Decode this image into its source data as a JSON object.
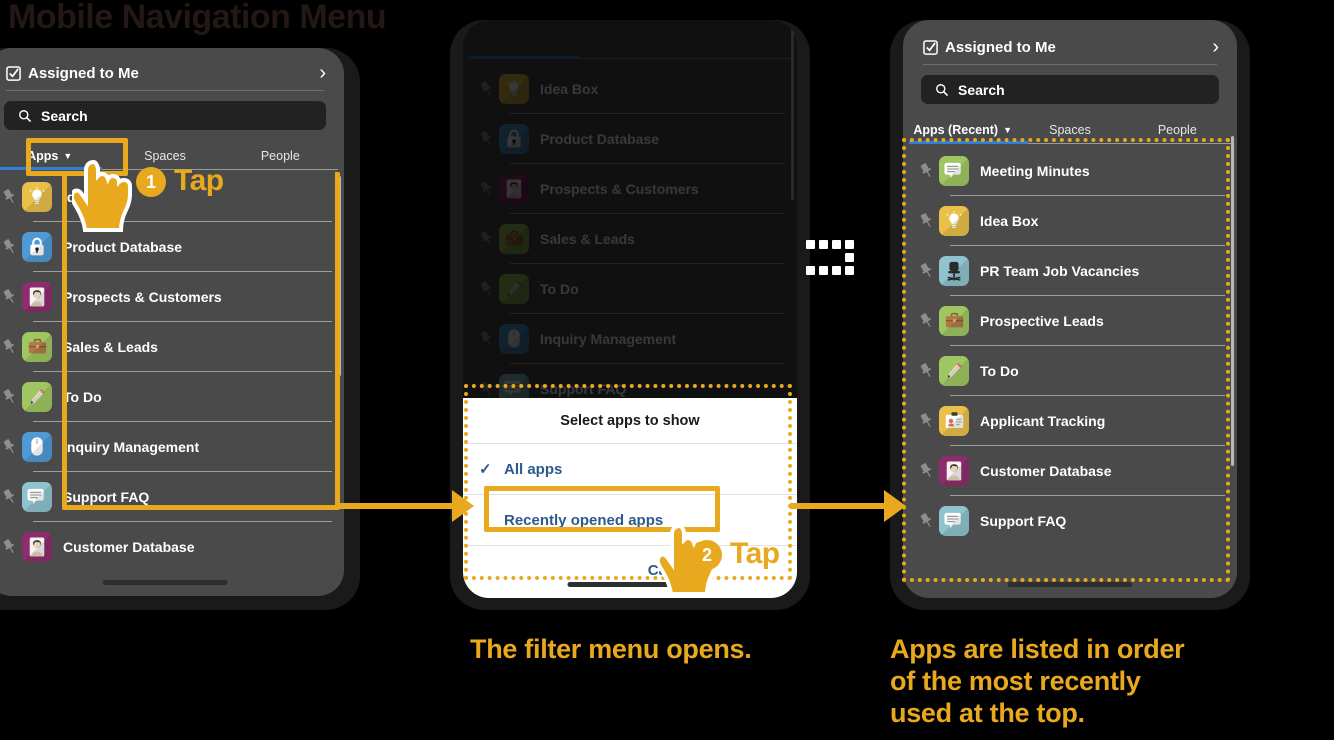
{
  "page": {
    "title": "Mobile Navigation Menu"
  },
  "colors": {
    "accent": "#e8a91e",
    "title": "#231815",
    "tab_active": "#2f80d8",
    "dialog_text": "#2b5a8c"
  },
  "common": {
    "assigned_label": "Assigned to Me",
    "assigned_icon": "checkbox-icon",
    "chevron": "›",
    "search_placeholder": "Search",
    "search_icon": "search-icon",
    "pin_icon": "pin-icon",
    "caret": "▼"
  },
  "phone1": {
    "tabs": [
      {
        "label": "Apps",
        "active": true,
        "caret": true
      },
      {
        "label": "Spaces",
        "active": false,
        "caret": false
      },
      {
        "label": "People",
        "active": false,
        "caret": false
      }
    ],
    "apps": [
      {
        "name": "Idea Box",
        "icon": "lightbulb-icon",
        "bg": "#e8c04a",
        "glyph": "💡"
      },
      {
        "name": "Product Database",
        "icon": "lock-icon",
        "bg": "#4f9ad4",
        "glyph": "🔒"
      },
      {
        "name": "Prospects & Customers",
        "icon": "person-badge-icon",
        "bg": "#8e2d6e",
        "glyph": "👤"
      },
      {
        "name": "Sales & Leads",
        "icon": "briefcase-icon",
        "bg": "#9fc661",
        "glyph": "💼"
      },
      {
        "name": "To Do",
        "icon": "pencil-icon",
        "bg": "#9fc661",
        "glyph": "✏"
      },
      {
        "name": "Inquiry Management",
        "icon": "mouse-icon",
        "bg": "#4f9ad4",
        "glyph": "🖱"
      },
      {
        "name": "Support FAQ",
        "icon": "chat-icon",
        "bg": "#8fc3ce",
        "glyph": "💬"
      },
      {
        "name": "Customer Database",
        "icon": "person-badge-icon",
        "bg": "#8e2d6e",
        "glyph": "👤"
      }
    ]
  },
  "phone2": {
    "apps": [
      {
        "name": "Idea Box",
        "icon": "lightbulb-icon",
        "bg": "#e8c04a",
        "glyph": "💡"
      },
      {
        "name": "Product Database",
        "icon": "lock-icon",
        "bg": "#4f9ad4",
        "glyph": "🔒"
      },
      {
        "name": "Prospects & Customers",
        "icon": "person-badge-icon",
        "bg": "#8e2d6e",
        "glyph": "👤"
      },
      {
        "name": "Sales & Leads",
        "icon": "briefcase-icon",
        "bg": "#9fc661",
        "glyph": "💼"
      },
      {
        "name": "To Do",
        "icon": "pencil-icon",
        "bg": "#9fc661",
        "glyph": "✏"
      },
      {
        "name": "Inquiry Management",
        "icon": "mouse-icon",
        "bg": "#4f9ad4",
        "glyph": "🖱"
      },
      {
        "name": "Support FAQ",
        "icon": "chat-icon",
        "bg": "#8fc3ce",
        "glyph": "💬"
      }
    ],
    "dialog": {
      "title": "Select apps to show",
      "items": [
        {
          "label": "All apps",
          "checked": true
        },
        {
          "label": "Recently opened apps",
          "checked": false
        }
      ],
      "cancel": "Cancel"
    }
  },
  "phone3": {
    "tabs": [
      {
        "label": "Apps (Recent)",
        "active": true,
        "caret": true
      },
      {
        "label": "Spaces",
        "active": false,
        "caret": false
      },
      {
        "label": "People",
        "active": false,
        "caret": false
      }
    ],
    "apps": [
      {
        "name": "Meeting Minutes",
        "icon": "chat-icon",
        "bg": "#9fc661",
        "glyph": "💬"
      },
      {
        "name": "Idea Box",
        "icon": "lightbulb-icon",
        "bg": "#e8c04a",
        "glyph": "💡"
      },
      {
        "name": "PR Team Job Vacancies",
        "icon": "office-chair-icon",
        "bg": "#8fc3ce",
        "glyph": "💺"
      },
      {
        "name": "Prospective Leads",
        "icon": "briefcase-icon",
        "bg": "#9fc661",
        "glyph": "💼"
      },
      {
        "name": "To Do",
        "icon": "pencil-icon",
        "bg": "#9fc661",
        "glyph": "✏"
      },
      {
        "name": "Applicant Tracking",
        "icon": "id-card-icon",
        "bg": "#e8c04a",
        "glyph": "📇"
      },
      {
        "name": "Customer Database",
        "icon": "person-badge-icon",
        "bg": "#8e2d6e",
        "glyph": "👤"
      },
      {
        "name": "Support FAQ",
        "icon": "chat-icon",
        "bg": "#8fc3ce",
        "glyph": "💬"
      }
    ]
  },
  "annotations": {
    "step1": {
      "number": "1",
      "word": "Tap"
    },
    "step2": {
      "number": "2",
      "word": "Tap"
    },
    "caption2": "The filter menu opens.",
    "caption3_line1": "Apps are listed in order",
    "caption3_line2": "of the most recently",
    "caption3_line3": "used at the top."
  }
}
